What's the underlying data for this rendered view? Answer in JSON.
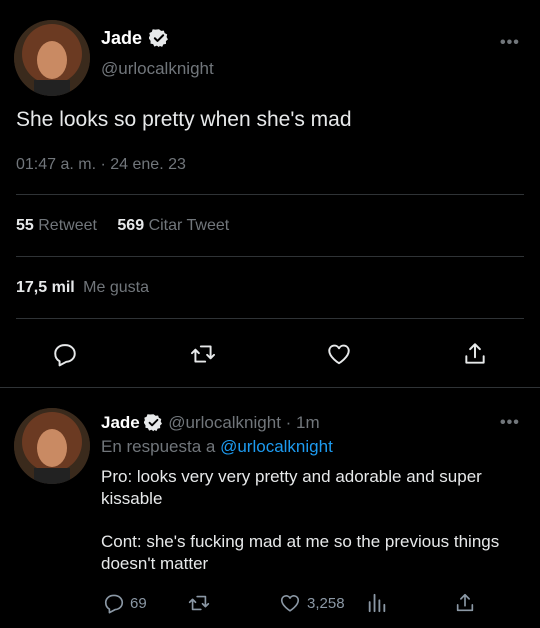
{
  "main_tweet": {
    "display_name": "Jade",
    "handle": "@urlocalknight",
    "text": "She looks so pretty when she's mad",
    "timestamp": "01:47 a. m. · 24 ene. 23",
    "stats": {
      "retweets_count": "55",
      "retweets_label": "Retweet",
      "quotes_count": "569",
      "quotes_label": "Citar Tweet",
      "likes_count": "17,5 mil",
      "likes_label": "Me gusta"
    },
    "actions": [
      "reply-icon",
      "retweet-icon",
      "like-icon",
      "share-icon"
    ]
  },
  "reply_tweet": {
    "display_name": "Jade",
    "handle": "@urlocalknight",
    "time": "· 1m",
    "replying_prefix": "En respuesta a",
    "replying_to": "@urlocalknight",
    "paragraph1": "Pro: looks very very pretty and adorable and super kissable",
    "paragraph2": "Cont: she's fucking mad at me so the previous things doesn't matter",
    "replies": "69",
    "likes": "3,258"
  },
  "colors": {
    "background": "#000000",
    "text": "#e7e9ea",
    "muted": "#71767b",
    "link": "#1d9bf0",
    "divider": "#2f3336"
  }
}
